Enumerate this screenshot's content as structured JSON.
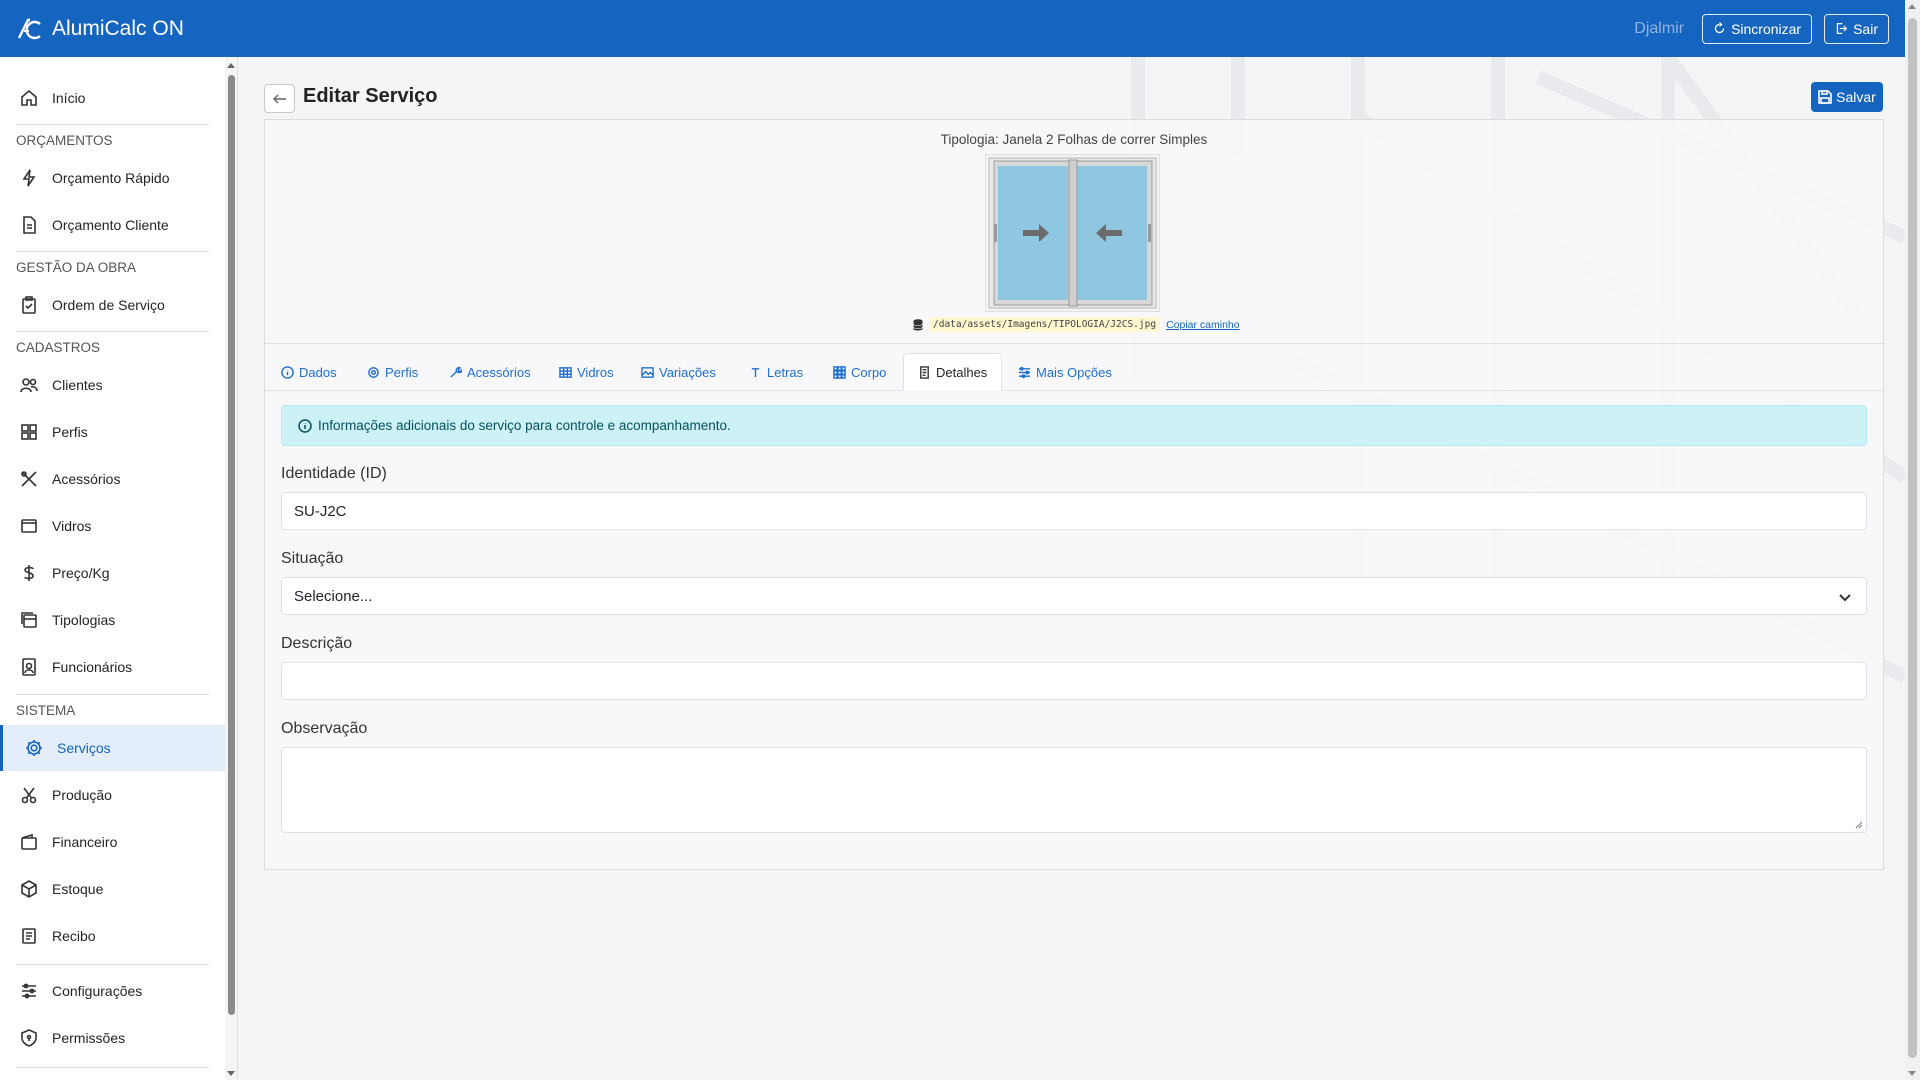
{
  "app": {
    "title": "AlumiCalc ON"
  },
  "topbar": {
    "user": "Djalmir",
    "sync_label": "Sincronizar",
    "logout_label": "Sair"
  },
  "sidebar": {
    "inicio": "Início",
    "sections": {
      "orcamentos": "ORÇAMENTOS",
      "gestao": "GESTÃO DA OBRA",
      "cadastros": "CADASTROS",
      "sistema": "SISTEMA"
    },
    "items": {
      "orcamento_rapido": "Orçamento Rápido",
      "orcamento_cliente": "Orçamento Cliente",
      "ordem_servico": "Ordem de Serviço",
      "clientes": "Clientes",
      "perfis": "Perfis",
      "acessorios": "Acessórios",
      "vidros": "Vidros",
      "preco_kg": "Preço/Kg",
      "tipologias": "Tipologias",
      "funcionarios": "Funcionários",
      "servicos": "Serviços",
      "producao": "Produção",
      "financeiro": "Financeiro",
      "estoque": "Estoque",
      "recibo": "Recibo",
      "configuracoes": "Configurações",
      "permissoes": "Permissões"
    },
    "active": "servicos"
  },
  "page": {
    "title": "Editar Serviço",
    "save_label": "Salvar",
    "tipologia_label": "Tipologia: Janela 2 Folhas de correr Simples",
    "image_path": "/data/assets/Imagens/TIPOLOGIA/J2CS.jpg",
    "copy_path_label": "Copiar caminho"
  },
  "tabs": {
    "dados": "Dados",
    "perfis": "Perfis",
    "acessorios": "Acessórios",
    "vidros": "Vidros",
    "variacoes": "Variações",
    "letras": "Letras",
    "corpo": "Corpo",
    "detalhes": "Detalhes",
    "mais_opcoes": "Mais Opções",
    "active": "detalhes"
  },
  "details": {
    "info": "Informações adicionais do serviço para controle e acompanhamento.",
    "identidade_label": "Identidade (ID)",
    "identidade_value": "SU-J2C",
    "situacao_label": "Situação",
    "situacao_value": "Selecione...",
    "descricao_label": "Descrição",
    "descricao_value": "",
    "observacao_label": "Observação",
    "observacao_value": ""
  },
  "colors": {
    "primary": "#1565c0",
    "alert_bg": "#ccf2f7",
    "window_glass": "#8fc7e0"
  }
}
